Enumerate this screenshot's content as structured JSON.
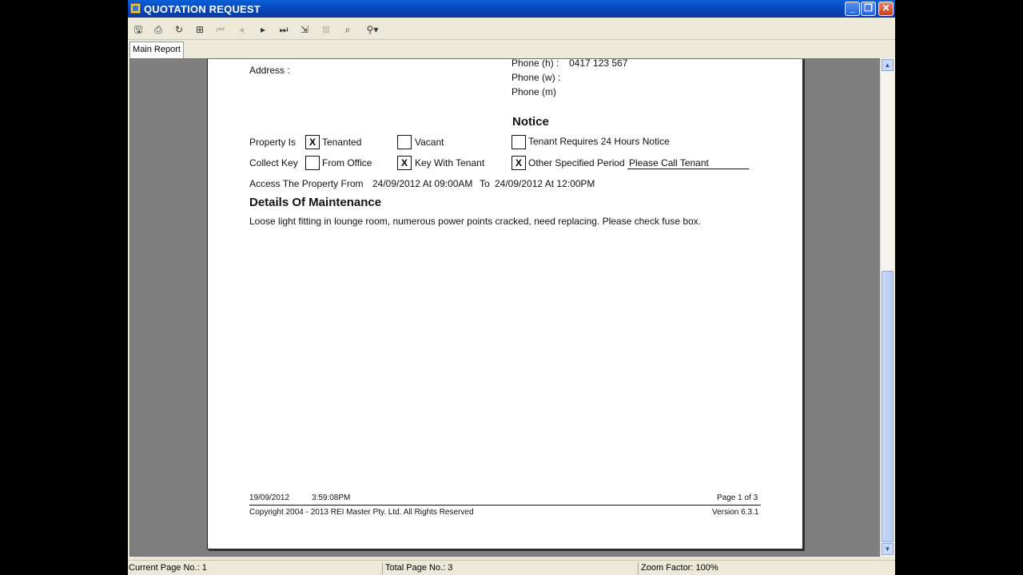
{
  "window": {
    "title": "QUOTATION REQUEST"
  },
  "toolbar": {
    "buttons": [
      "export-icon",
      "print-icon",
      "refresh-icon",
      "group-tree-icon",
      "first-page-icon",
      "previous-page-icon",
      "next-page-icon",
      "last-page-icon",
      "goto-page-icon",
      "stop-icon",
      "search-icon",
      "zoom-icon"
    ]
  },
  "tabs": {
    "main_report": "Main Report"
  },
  "report": {
    "address_label": "Address :",
    "phone_h_label": "Phone (h) :",
    "phone_h_value": "0417 123 567",
    "phone_w_label": "Phone (w) :",
    "phone_m_label": "Phone (m)",
    "notice_heading": "Notice",
    "property_is_label": "Property Is",
    "tenanted_label": "Tenanted",
    "tenanted_checked": "X",
    "vacant_label": "Vacant",
    "requires_notice_label": "Tenant Requires 24 Hours Notice",
    "collect_key_label": "Collect Key",
    "from_office_label": "From Office",
    "key_with_tenant_label": "Key With Tenant",
    "key_with_tenant_checked": "X",
    "other_period_label": "Other Specified Period",
    "other_period_checked": "X",
    "other_period_value": "Please Call Tenant",
    "access_label": "Access The Property From",
    "access_from": "24/09/2012 At 09:00AM",
    "access_to_label": "To",
    "access_to": "24/09/2012 At 12:00PM",
    "details_heading": "Details Of Maintenance",
    "details_text": "Loose light fitting in lounge room, numerous power points cracked, need replacing. Please check fuse box.",
    "footer_date": "19/09/2012",
    "footer_time": "3:59:08PM",
    "footer_page": "Page 1 of 3",
    "footer_copyright": "Copyright 2004 - 2013 REI Master Pty. Ltd.  All Rights Reserved",
    "footer_version": "Version 6.3.1"
  },
  "status": {
    "current_page": "Current Page No.: 1",
    "total_page": "Total Page No.: 3",
    "zoom": "Zoom Factor: 100%"
  }
}
